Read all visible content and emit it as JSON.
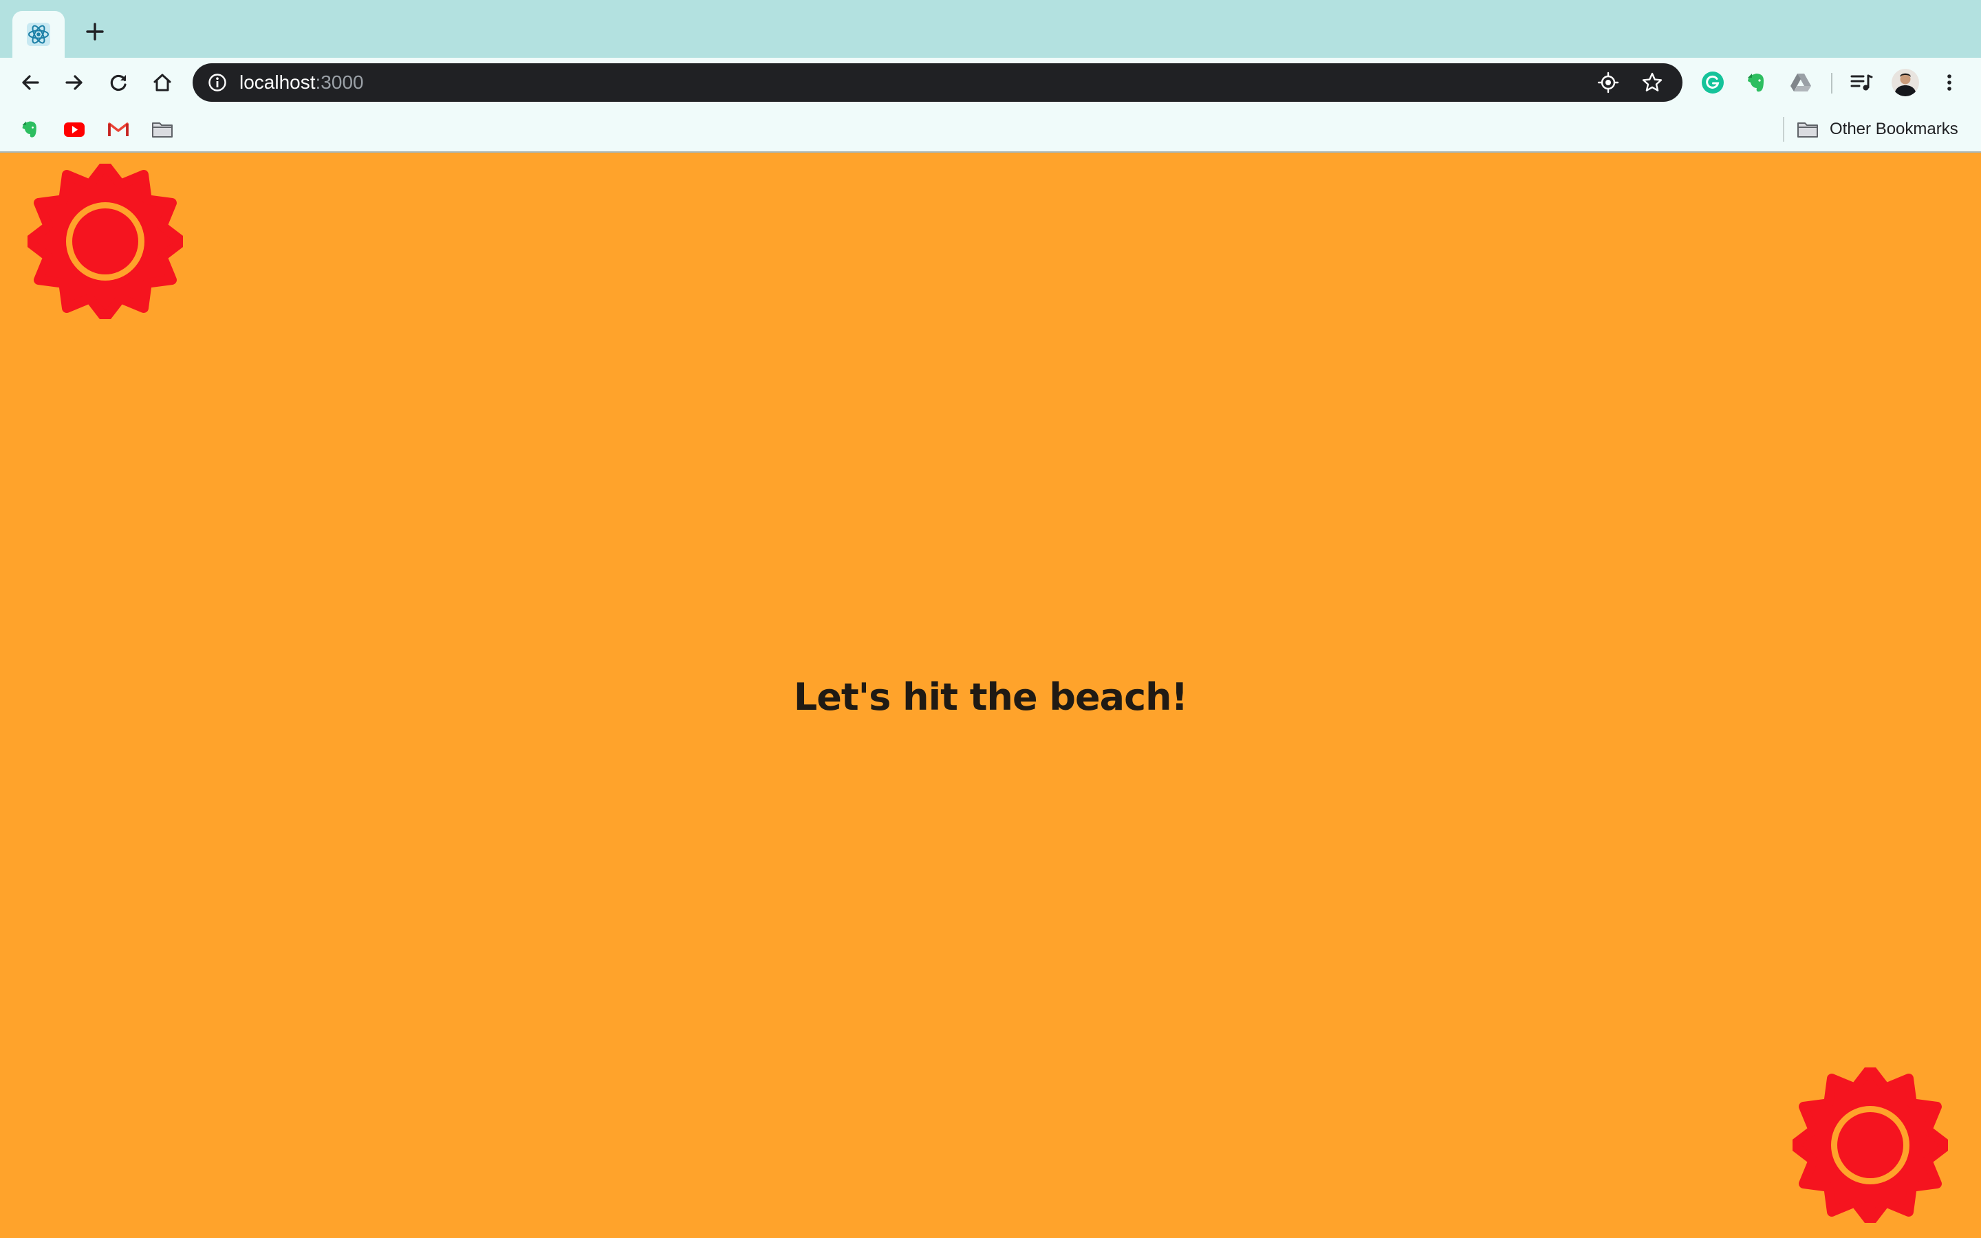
{
  "browser": {
    "tab": {
      "icon": "react-atom-icon"
    },
    "new_tab_icon": "plus-icon",
    "nav": {
      "back_icon": "arrow-left-icon",
      "forward_icon": "arrow-right-icon",
      "reload_icon": "reload-icon",
      "home_icon": "home-icon"
    },
    "omnibox": {
      "host": "localhost",
      "port": ":3000",
      "info_icon": "info-icon",
      "location_icon": "location-target-icon",
      "bookmark_star_icon": "star-icon"
    },
    "extensions": [
      "grammarly-icon",
      "evernote-icon",
      "google-drive-icon",
      "reading-list-icon",
      "profile-avatar",
      "more-vert-icon"
    ],
    "bookmarks": {
      "items": [
        "evernote-icon",
        "youtube-icon",
        "gmail-icon",
        "folder-icon"
      ],
      "other_label": "Other Bookmarks"
    }
  },
  "page": {
    "headline": "Let's hit the beach!",
    "sun_icon": "sun-icon",
    "colors": {
      "background": "#ffa32b",
      "sun": "#f5141f",
      "text": "#1f1a14"
    }
  }
}
